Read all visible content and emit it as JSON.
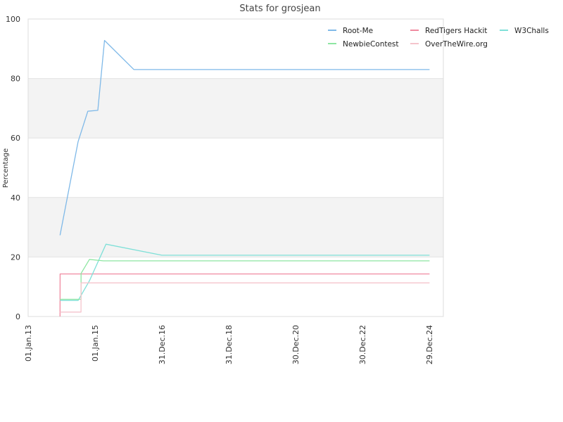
{
  "chart_data": {
    "type": "line",
    "title": "Stats for grosjean",
    "xlabel": "",
    "ylabel": "Percentage",
    "ylim": [
      0,
      100
    ],
    "y_ticks": [
      "0",
      "20",
      "40",
      "60",
      "80",
      "100"
    ],
    "x_ticks": [
      {
        "label": "01.Jan.13",
        "date": "2013-01-01"
      },
      {
        "label": "01.Jan.15",
        "date": "2015-01-01"
      },
      {
        "label": "31.Dec.16",
        "date": "2016-12-31"
      },
      {
        "label": "31.Dec.18",
        "date": "2018-12-31"
      },
      {
        "label": "30.Dec.20",
        "date": "2020-12-30"
      },
      {
        "label": "30.Dec.22",
        "date": "2022-12-30"
      },
      {
        "label": "29.Dec.24",
        "date": "2024-12-29"
      }
    ],
    "xlim": [
      "2013-01-01",
      "2025-06-01"
    ],
    "grid": "horizontal bands",
    "legend": "top-right",
    "series": [
      {
        "name": "Root-Me",
        "color": "#7fb9e8",
        "points": [
          [
            "2013-12-15",
            27.3
          ],
          [
            "2014-07-01",
            58.8
          ],
          [
            "2014-10-15",
            69.0
          ],
          [
            "2015-02-01",
            69.3
          ],
          [
            "2015-04-15",
            92.8
          ],
          [
            "2016-03-01",
            83.0
          ],
          [
            "2025-01-01",
            83.0
          ]
        ]
      },
      {
        "name": "RedTigers Hackit",
        "color": "#f08aa0",
        "points": [
          [
            "2013-12-15",
            0.0
          ],
          [
            "2013-12-16",
            14.3
          ],
          [
            "2025-01-01",
            14.3
          ]
        ]
      },
      {
        "name": "W3Challs",
        "color": "#7fe0d8",
        "points": [
          [
            "2013-12-15",
            5.4
          ],
          [
            "2014-07-01",
            5.4
          ],
          [
            "2014-11-01",
            12.0
          ],
          [
            "2015-05-01",
            24.3
          ],
          [
            "2017-01-01",
            20.6
          ],
          [
            "2025-01-01",
            20.6
          ]
        ]
      },
      {
        "name": "NewbieContest",
        "color": "#8ee6a2",
        "points": [
          [
            "2013-12-15",
            5.8
          ],
          [
            "2014-08-01",
            5.8
          ],
          [
            "2014-08-02",
            14.5
          ],
          [
            "2014-11-01",
            19.2
          ],
          [
            "2015-04-01",
            18.7
          ],
          [
            "2025-01-01",
            18.7
          ]
        ]
      },
      {
        "name": "OverTheWire.org",
        "color": "#f5c4cc",
        "points": [
          [
            "2013-12-15",
            1.5
          ],
          [
            "2014-08-01",
            1.5
          ],
          [
            "2014-08-02",
            11.3
          ],
          [
            "2015-01-01",
            11.3
          ],
          [
            "2025-01-01",
            11.3
          ]
        ]
      }
    ]
  }
}
